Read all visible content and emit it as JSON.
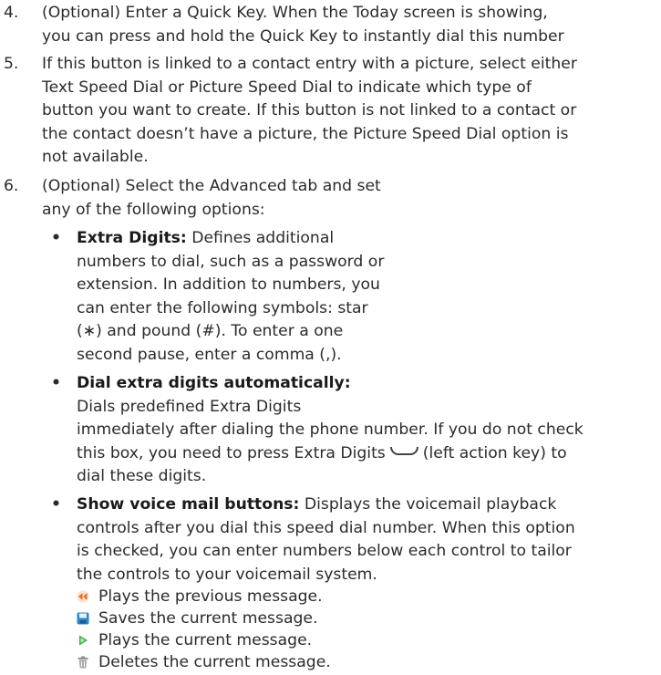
{
  "steps": [
    {
      "number": "4.",
      "lines": [
        "(Optional) Enter a Quick Key. When the Today screen is showing,",
        "you can press and hold the Quick Key to instantly dial this number"
      ]
    },
    {
      "number": "5.",
      "lines": [
        "If this button is linked to a contact entry with a picture, select either",
        "Text Speed Dial or Picture Speed Dial to indicate which type of",
        "button you want to create. If this button is not linked to a contact or",
        "the contact doesn’t have a picture, the Picture Speed Dial option is",
        "not available."
      ]
    },
    {
      "number": "6.",
      "lines": [
        "(Optional) Select the Advanced tab and set",
        "any of the following options:"
      ]
    }
  ],
  "bullets": [
    {
      "term": "Extra Digits:",
      "lines": [
        "Defines additional",
        "numbers to dial, such as a password or",
        "extension. In addition to numbers, you",
        "can enter the following symbols: star",
        "(∗) and pound (#). To enter a one",
        "second pause, enter a comma (,)."
      ]
    },
    {
      "term": "Dial extra digits automatically:",
      "lines": [
        "Dials predefined Extra Digits",
        "immediately after dialing the phone number. If you do not check",
        "this box, you need to press Extra Digits",
        "(left action key) to",
        "dial these digits."
      ]
    },
    {
      "term": "Show voice mail buttons:",
      "lines": [
        "Displays the voicemail playback",
        "controls after you dial this speed dial number. When this option",
        "is checked, you can enter numbers below each control to tailor",
        "the controls to your voicemail system."
      ]
    }
  ],
  "bullet_symbol": "•",
  "softkey_icon": "left-action-key-icon",
  "voicemail_controls": [
    {
      "icon": "previous-message-icon",
      "color": "#e8702a",
      "label": "Plays the previous message."
    },
    {
      "icon": "save-message-icon",
      "color": "#2f86c9",
      "label": "Saves the current message."
    },
    {
      "icon": "play-message-icon",
      "color": "#3fae3a",
      "label": "Plays the current message."
    },
    {
      "icon": "delete-message-icon",
      "color": "#8a8a8a",
      "label": "Deletes the current message."
    }
  ]
}
